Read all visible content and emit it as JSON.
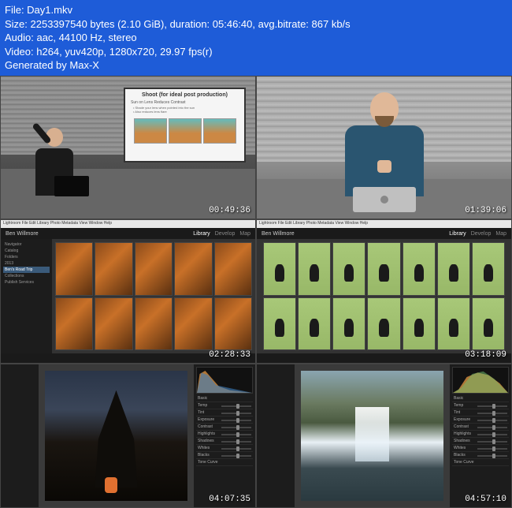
{
  "header": {
    "line1": "File: Day1.mkv",
    "line2": "Size: 2253397540 bytes (2.10 GiB), duration: 05:46:40, avg.bitrate: 867 kb/s",
    "line3": "Audio: aac, 44100 Hz, stereo",
    "line4": "Video: h264, yuv420p, 1280x720, 29.97 fps(r)",
    "line5": "Generated by Max-X"
  },
  "tiles": [
    {
      "timestamp": "00:49:36",
      "slide_title": "Shoot (for ideal post production)",
      "slide_sub": "Sun on Lens Reduces Contrast",
      "slide_b1": "• Shade your lens when pointed into the sun",
      "slide_b2": "• Also reduces lens flare"
    },
    {
      "timestamp": "01:39:06"
    },
    {
      "timestamp": "02:28:33",
      "user": "Ben Willmore",
      "tabs": [
        "Library",
        "Develop",
        "Map"
      ],
      "active_tab": 0,
      "menubar": "Lightroom  File  Edit  Library  Photo  Metadata  View  Window  Help",
      "nav": [
        "Navigator",
        "Catalog",
        "Folders",
        "  2013",
        "  Ben's Road Trip",
        "Collections",
        "Publish Services"
      ]
    },
    {
      "timestamp": "03:18:09",
      "user": "Ben Willmore",
      "tabs": [
        "Library",
        "Develop",
        "Map"
      ],
      "active_tab": 0,
      "menubar": "Lightroom  File  Edit  Library  Photo  Metadata  View  Window  Help"
    },
    {
      "timestamp": "04:07:35",
      "sliders": [
        "Temp",
        "Tint",
        "Exposure",
        "Contrast",
        "Highlights",
        "Shadows",
        "Whites",
        "Blacks"
      ],
      "section": "Basic",
      "histogram": "Histogram",
      "tonecurve": "Tone Curve"
    },
    {
      "timestamp": "04:57:10",
      "sliders": [
        "Temp",
        "Tint",
        "Exposure",
        "Contrast",
        "Highlights",
        "Shadows",
        "Whites",
        "Blacks"
      ],
      "section": "Basic",
      "histogram": "Histogram",
      "tonecurve": "Tone Curve"
    }
  ]
}
